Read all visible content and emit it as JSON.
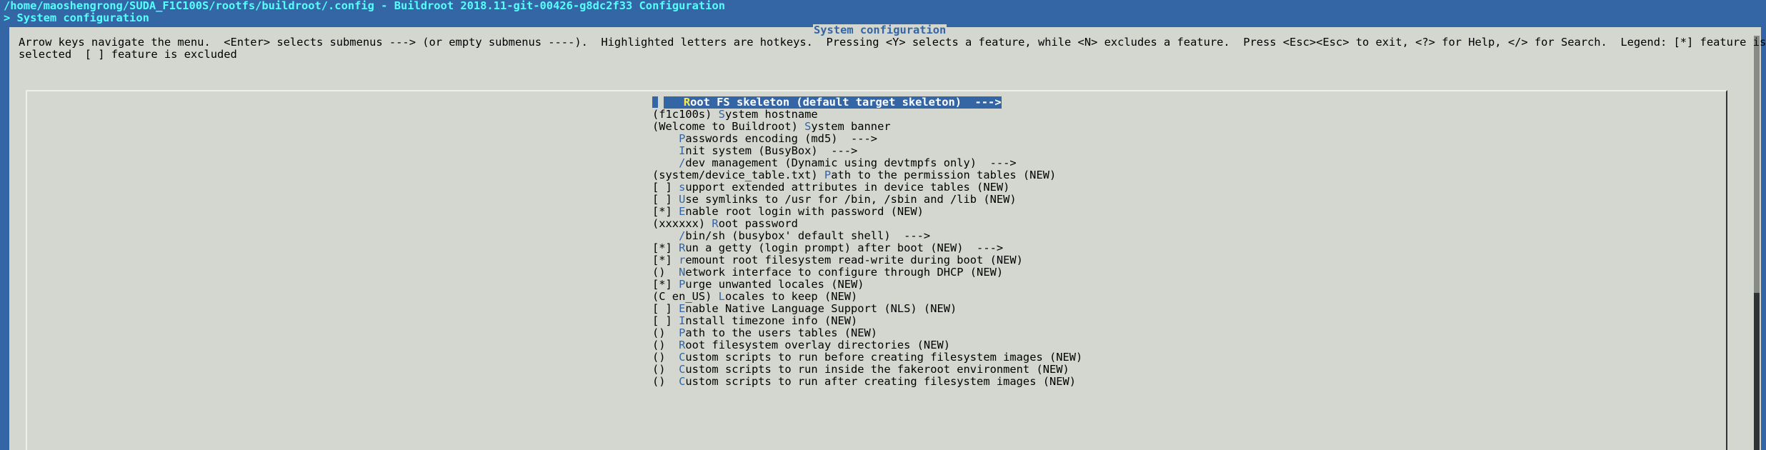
{
  "window": {
    "title": "/home/maoshengrong/SUDA_F1C100S/rootfs/buildroot/.config - Buildroot 2018.11-git-00426-g8dc2f33 Configuration",
    "breadcrumb": "> System configuration"
  },
  "dialog": {
    "title": "System configuration",
    "help_text": "Arrow keys navigate the menu.  <Enter> selects submenus ---> (or empty submenus ----).  Highlighted letters are hotkeys.  Pressing <Y> selects a feature, while <N> excludes a feature.  Press <Esc><Esc> to exit, <?> for Help, </> for Search.  Legend: [*] feature is\nselected  [ ] feature is excluded"
  },
  "menu": {
    "items": [
      {
        "prefix": "   ",
        "hot": "R",
        "rest": "oot FS skeleton (default target skeleton)  --->"
      },
      {
        "prefix": "(f1c100s) ",
        "hot": "S",
        "rest": "ystem hostname"
      },
      {
        "prefix": "(Welcome to Buildroot) ",
        "hot": "S",
        "rest": "ystem banner"
      },
      {
        "prefix": "    ",
        "hot": "P",
        "rest": "asswords encoding (md5)  --->"
      },
      {
        "prefix": "    ",
        "hot": "I",
        "rest": "nit system (BusyBox)  --->"
      },
      {
        "prefix": "    ",
        "hot": "/",
        "rest": "dev management (Dynamic using devtmpfs only)  --->"
      },
      {
        "prefix": "(system/device_table.txt) ",
        "hot": "P",
        "rest": "ath to the permission tables (NEW)"
      },
      {
        "prefix": "[ ] ",
        "hot": "s",
        "rest": "upport extended attributes in device tables (NEW)"
      },
      {
        "prefix": "[ ] ",
        "hot": "U",
        "rest": "se symlinks to /usr for /bin, /sbin and /lib (NEW)"
      },
      {
        "prefix": "[*] ",
        "hot": "E",
        "rest": "nable root login with password (NEW)"
      },
      {
        "prefix": "(xxxxxx) ",
        "hot": "R",
        "rest": "oot password"
      },
      {
        "prefix": "    ",
        "hot": "/",
        "rest": "bin/sh (busybox' default shell)  --->"
      },
      {
        "prefix": "[*] ",
        "hot": "R",
        "rest": "un a getty (login prompt) after boot (NEW)  --->"
      },
      {
        "prefix": "[*] ",
        "hot": "r",
        "rest": "emount root filesystem read-write during boot (NEW)"
      },
      {
        "prefix": "()  ",
        "hot": "N",
        "rest": "etwork interface to configure through DHCP (NEW)"
      },
      {
        "prefix": "[*] ",
        "hot": "P",
        "rest": "urge unwanted locales (NEW)"
      },
      {
        "prefix": "(C en_US) ",
        "hot": "L",
        "rest": "ocales to keep (NEW)"
      },
      {
        "prefix": "[ ] ",
        "hot": "E",
        "rest": "nable Native Language Support (NLS) (NEW)"
      },
      {
        "prefix": "[ ] ",
        "hot": "I",
        "rest": "nstall timezone info (NEW)"
      },
      {
        "prefix": "()  ",
        "hot": "P",
        "rest": "ath to the users tables (NEW)"
      },
      {
        "prefix": "()  ",
        "hot": "R",
        "rest": "oot filesystem overlay directories (NEW)"
      },
      {
        "prefix": "()  ",
        "hot": "C",
        "rest": "ustom scripts to run before creating filesystem images (NEW)"
      },
      {
        "prefix": "()  ",
        "hot": "C",
        "rest": "ustom scripts to run inside the fakeroot environment (NEW)"
      },
      {
        "prefix": "()  ",
        "hot": "C",
        "rest": "ustom scripts to run after creating filesystem images (NEW)"
      }
    ]
  },
  "colors": {
    "background": "#3465a4",
    "panel": "#d3d7cf",
    "highlight": "#3465a4",
    "hotkey": "#3465a4",
    "hotkey_selected": "#fce94f",
    "title_text": "#55ffff"
  }
}
